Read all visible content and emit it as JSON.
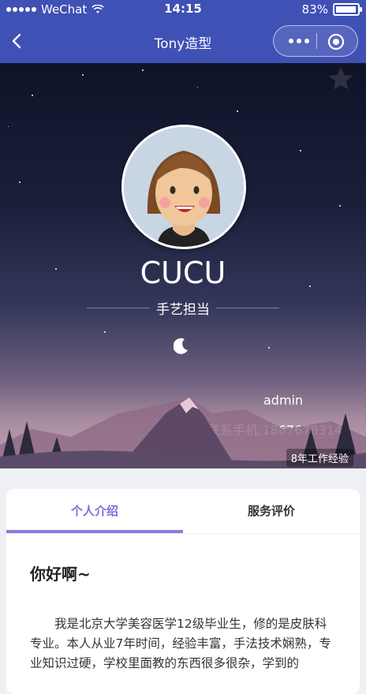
{
  "statusbar": {
    "carrier": "WeChat",
    "time": "14:15",
    "battery": "83%"
  },
  "navbar": {
    "title": "Tony造型"
  },
  "profile": {
    "name": "CUCU",
    "tagline": "手艺担当",
    "owner": "admin",
    "phone_label": "联系手机:18676783145",
    "experience": "8年工作经验"
  },
  "tabs": [
    {
      "label": "个人介绍",
      "active": true
    },
    {
      "label": "服务评价",
      "active": false
    }
  ],
  "intro": {
    "greeting": "你好啊~",
    "text": "我是北京大学美容医学12级毕业生，修的是皮肤科专业。本人从业7年时间，经验丰富，手法技术娴熟，专业知识过硬，学校里面教的东西很多很杂，学到的"
  },
  "colors": {
    "accent": "#3f51b5",
    "tab_active": "#7b6fd9"
  }
}
